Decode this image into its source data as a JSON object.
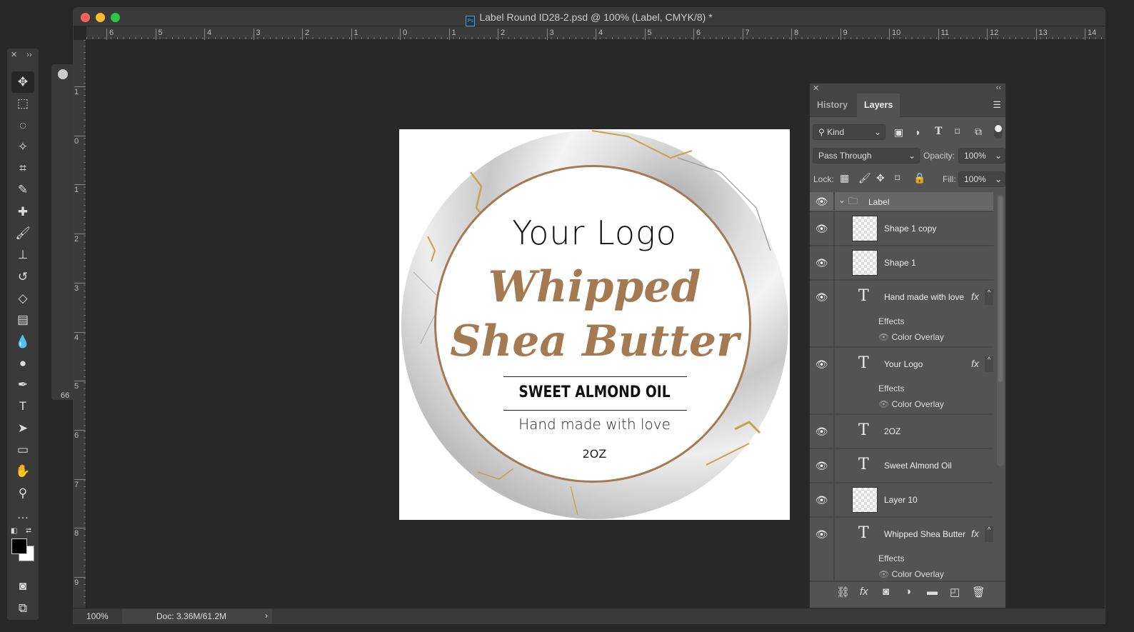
{
  "window": {
    "title": "Label Round ID28-2.psd @ 100% (Label, CMYK/8) *",
    "app_icon": "Ps"
  },
  "rulers": {
    "horizontal": [
      "6",
      "5",
      "4",
      "3",
      "2",
      "1",
      "0",
      "1",
      "2",
      "3",
      "4",
      "5",
      "6",
      "7",
      "8",
      "9",
      "10",
      "11",
      "12",
      "13",
      "14"
    ],
    "vertical": [
      "1",
      "0",
      "1",
      "2",
      "3",
      "4",
      "5",
      "6",
      "7",
      "8",
      "9"
    ]
  },
  "status": {
    "zoom": "100%",
    "doc": "Doc: 3.36M/61.2M",
    "arrow": "›"
  },
  "mini_panel": {
    "value": "66"
  },
  "tools": [
    {
      "name": "move-tool",
      "glyph": "✥"
    },
    {
      "name": "marquee-tool",
      "glyph": "⬚"
    },
    {
      "name": "lasso-tool",
      "glyph": "◌"
    },
    {
      "name": "magic-wand-tool",
      "glyph": "✧"
    },
    {
      "name": "crop-tool",
      "glyph": "⌗"
    },
    {
      "name": "eyedropper-tool",
      "glyph": "✎"
    },
    {
      "name": "healing-brush-tool",
      "glyph": "✚"
    },
    {
      "name": "brush-tool",
      "glyph": "🖌"
    },
    {
      "name": "clone-stamp-tool",
      "glyph": "⊥"
    },
    {
      "name": "history-brush-tool",
      "glyph": "↺"
    },
    {
      "name": "eraser-tool",
      "glyph": "◇"
    },
    {
      "name": "gradient-tool",
      "glyph": "▤"
    },
    {
      "name": "blur-tool",
      "glyph": "💧"
    },
    {
      "name": "dodge-tool",
      "glyph": "●"
    },
    {
      "name": "pen-tool",
      "glyph": "✒"
    },
    {
      "name": "type-tool",
      "glyph": "T"
    },
    {
      "name": "path-selection-tool",
      "glyph": "➤"
    },
    {
      "name": "rectangle-tool",
      "glyph": "▭"
    },
    {
      "name": "hand-tool",
      "glyph": "✋"
    },
    {
      "name": "zoom-tool",
      "glyph": "⚲"
    },
    {
      "name": "more-tools",
      "glyph": "…"
    }
  ],
  "colors": {
    "foreground": "#000000",
    "background": "#ffffff",
    "accent": "#a47a52"
  },
  "label": {
    "logo": "Your Logo",
    "title1": "Whipped",
    "title2": "Shea Butter",
    "subtitle": "SWEET ALMOND OIL",
    "tagline": "Hand made with love",
    "size": "2OZ"
  },
  "panel": {
    "tabs": [
      "History",
      "Layers"
    ],
    "kind": "Kind",
    "blend": "Pass Through",
    "opacity_label": "Opacity:",
    "opacity": "100%",
    "lock_label": "Lock:",
    "fill_label": "Fill:",
    "fill": "100%",
    "layers": [
      {
        "name": "Label",
        "type": "group"
      },
      {
        "name": "Shape 1 copy",
        "type": "shape"
      },
      {
        "name": "Shape 1",
        "type": "shape"
      },
      {
        "name": "Hand made with love",
        "type": "text",
        "fx": true,
        "effects": [
          "Color Overlay"
        ]
      },
      {
        "name": "Your Logo",
        "type": "text",
        "fx": true,
        "effects": [
          "Color Overlay"
        ]
      },
      {
        "name": "2OZ",
        "type": "text"
      },
      {
        "name": "Sweet Almond Oil",
        "type": "text"
      },
      {
        "name": "Layer 10",
        "type": "pixel"
      },
      {
        "name": "Whipped Shea Butter",
        "type": "text",
        "fx": true,
        "effects": [
          "Color Overlay"
        ]
      }
    ],
    "effects_label": "Effects",
    "fx_label": "fx"
  }
}
